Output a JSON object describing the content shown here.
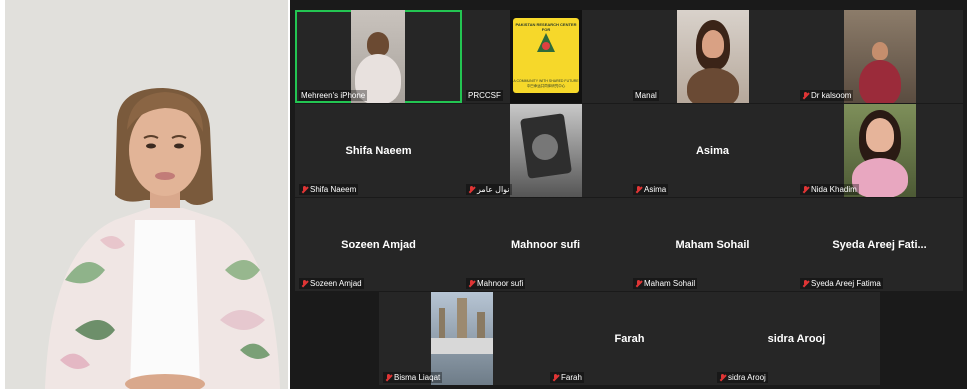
{
  "speaker": {
    "name": "active-speaker-video"
  },
  "tiles": [
    {
      "name": "Mehreen's iPhone",
      "label": "Mehreen's iPhone",
      "muted": false,
      "active": true,
      "video": "phone"
    },
    {
      "name": "PRCCSF",
      "label": "PRCCSF",
      "muted": false,
      "video": "logo",
      "logo_lines": [
        "PAKISTAN RESEARCH CENTER FOR",
        "A COMMUNITY WITH SHARED FUTURE",
        "中巴命运共同体研究中心"
      ]
    },
    {
      "name": "Manal",
      "label": "Manal",
      "muted": false,
      "video": "manal"
    },
    {
      "name": "Dr kalsoom",
      "label": "Dr kalsoom",
      "muted": true,
      "video": "kals"
    },
    {
      "name": "Shifa Naeem",
      "label": "Shifa Naeem",
      "muted": true,
      "big": "Shifa Naeem"
    },
    {
      "name": "نوال عامر",
      "label": "نوال عامر",
      "muted": true,
      "video": "nawal"
    },
    {
      "name": "Asima",
      "label": "Asima",
      "muted": true,
      "big": "Asima"
    },
    {
      "name": "Nida Khadim",
      "label": "Nida Khadim",
      "muted": true,
      "video": "nida"
    },
    {
      "name": "Sozeen Amjad",
      "label": "Sozeen Amjad",
      "muted": true,
      "big": "Sozeen Amjad"
    },
    {
      "name": "Mahnoor sufi",
      "label": "Mahnoor sufi",
      "muted": true,
      "big": "Mahnoor sufi"
    },
    {
      "name": "Maham Sohail",
      "label": "Maham Sohail",
      "muted": true,
      "big": "Maham Sohail"
    },
    {
      "name": "Syeda Areej Fatima",
      "label": "Syeda Areej Fatima",
      "muted": true,
      "big": "Syeda Areej Fati..."
    },
    {
      "name": "Bisma Liaqat",
      "label": "Bisma Liaqat",
      "muted": true,
      "video": "bisma"
    },
    {
      "name": "Farah",
      "label": "Farah",
      "muted": true,
      "big": "Farah"
    },
    {
      "name": "sidra Arooj",
      "label": "sidra Arooj",
      "muted": true,
      "big": "sidra Arooj"
    }
  ],
  "colors": {
    "active_border": "#23c552",
    "mic_muted": "#e03535",
    "tile_bg": "#262626",
    "grid_bg": "#1a1a1a"
  }
}
